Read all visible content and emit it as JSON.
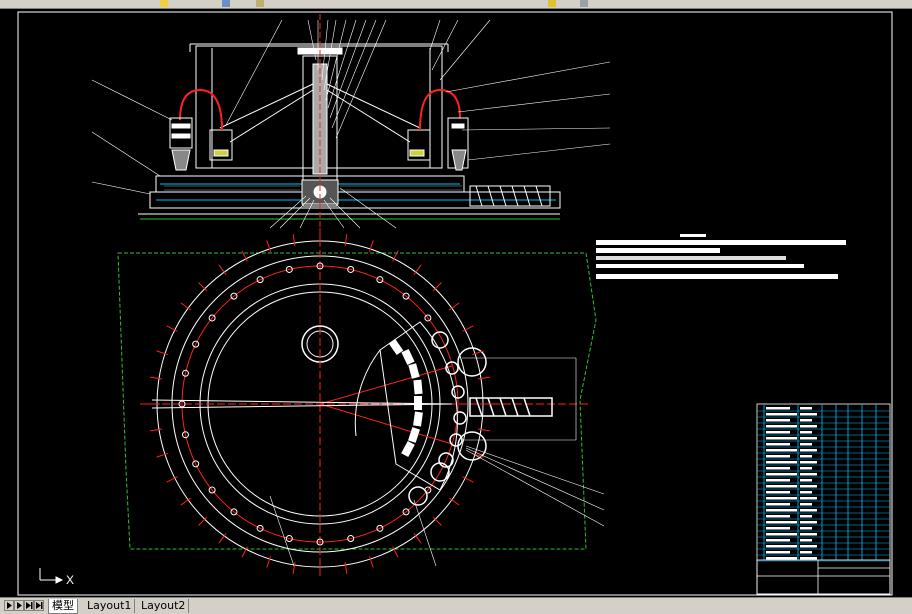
{
  "toolbar": {
    "items": [
      "pan-icon",
      "zoom-icon",
      "layer-icon",
      "properties-icon"
    ]
  },
  "drawing": {
    "colors": {
      "background": "#000000",
      "white_lines": "#ffffff",
      "red_lines": "#ff2020",
      "green_lines": "#30c030",
      "cyan_lines": "#00c0ff",
      "yellow": "#ffff00"
    }
  },
  "ucs": {
    "axis_label": "X"
  },
  "tabs": [
    {
      "label": "模型",
      "active": true
    },
    {
      "label": "Layout1",
      "active": false
    },
    {
      "label": "Layout2",
      "active": false
    }
  ]
}
